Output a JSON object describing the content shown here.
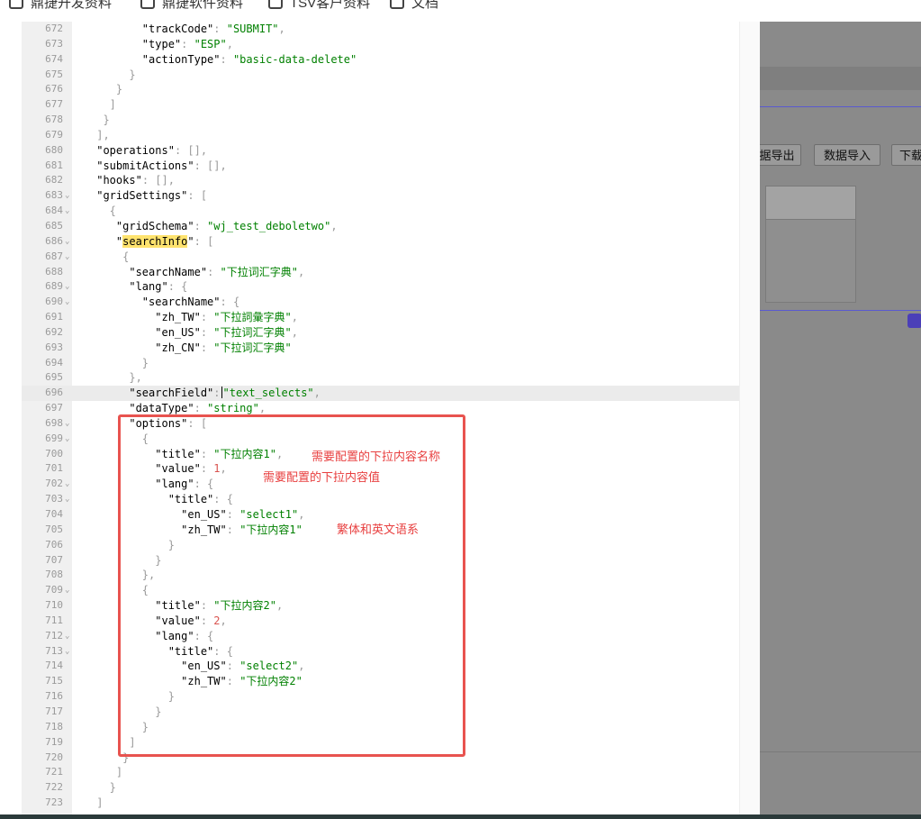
{
  "bookmarks": [
    {
      "label": "鼎捷开发资料"
    },
    {
      "label": "鼎捷软件资料"
    },
    {
      "label": "TSV客户资料"
    },
    {
      "label": "文档"
    }
  ],
  "editor": {
    "active_line": "696",
    "lines": [
      {
        "num": "672",
        "fold": false
      },
      {
        "num": "673",
        "fold": false
      },
      {
        "num": "674",
        "fold": false
      },
      {
        "num": "675",
        "fold": false
      },
      {
        "num": "676",
        "fold": false
      },
      {
        "num": "677",
        "fold": false
      },
      {
        "num": "678",
        "fold": false
      },
      {
        "num": "679",
        "fold": false
      },
      {
        "num": "680",
        "fold": false
      },
      {
        "num": "681",
        "fold": false
      },
      {
        "num": "682",
        "fold": false
      },
      {
        "num": "683",
        "fold": true
      },
      {
        "num": "684",
        "fold": true
      },
      {
        "num": "685",
        "fold": false
      },
      {
        "num": "686",
        "fold": true
      },
      {
        "num": "687",
        "fold": true
      },
      {
        "num": "688",
        "fold": false
      },
      {
        "num": "689",
        "fold": true
      },
      {
        "num": "690",
        "fold": true
      },
      {
        "num": "691",
        "fold": false
      },
      {
        "num": "692",
        "fold": false
      },
      {
        "num": "693",
        "fold": false
      },
      {
        "num": "694",
        "fold": false
      },
      {
        "num": "695",
        "fold": false
      },
      {
        "num": "696",
        "fold": false
      },
      {
        "num": "697",
        "fold": false
      },
      {
        "num": "698",
        "fold": true
      },
      {
        "num": "699",
        "fold": true
      },
      {
        "num": "700",
        "fold": false
      },
      {
        "num": "701",
        "fold": false
      },
      {
        "num": "702",
        "fold": true
      },
      {
        "num": "703",
        "fold": true
      },
      {
        "num": "704",
        "fold": false
      },
      {
        "num": "705",
        "fold": false
      },
      {
        "num": "706",
        "fold": false
      },
      {
        "num": "707",
        "fold": false
      },
      {
        "num": "708",
        "fold": false
      },
      {
        "num": "709",
        "fold": true
      },
      {
        "num": "710",
        "fold": false
      },
      {
        "num": "711",
        "fold": false
      },
      {
        "num": "712",
        "fold": true
      },
      {
        "num": "713",
        "fold": true
      },
      {
        "num": "714",
        "fold": false
      },
      {
        "num": "715",
        "fold": false
      },
      {
        "num": "716",
        "fold": false
      },
      {
        "num": "717",
        "fold": false
      },
      {
        "num": "718",
        "fold": false
      },
      {
        "num": "719",
        "fold": false
      },
      {
        "num": "720",
        "fold": false
      },
      {
        "num": "721",
        "fold": false
      },
      {
        "num": "722",
        "fold": false
      },
      {
        "num": "723",
        "fold": false
      }
    ],
    "code": {
      "trackCode_key": "\"trackCode\"",
      "trackCode_val": "\"SUBMIT\"",
      "type_key": "\"type\"",
      "type_val": "\"ESP\"",
      "actionType_key": "\"actionType\"",
      "actionType_val": "\"basic-data-delete\"",
      "operations_key": "\"operations\"",
      "submitActions_key": "\"submitActions\"",
      "hooks_key": "\"hooks\"",
      "gridSettings_key": "\"gridSettings\"",
      "gridSchema_key": "\"gridSchema\"",
      "gridSchema_val": "\"wj_test_deboletwo\"",
      "searchInfo_key": "searchInfo",
      "searchName_key": "\"searchName\"",
      "searchName_val": "\"下拉词汇字典\"",
      "lang_key": "\"lang\"",
      "zh_TW_key": "\"zh_TW\"",
      "zh_TW_val": "\"下拉詞彙字典\"",
      "en_US_key": "\"en_US\"",
      "en_US_val": "\"下拉词汇字典\"",
      "zh_CN_key": "\"zh_CN\"",
      "zh_CN_val": "\"下拉词汇字典\"",
      "searchField_key": "\"searchField\"",
      "searchField_val": "\"text_selects\"",
      "dataType_key": "\"dataType\"",
      "dataType_val": "\"string\"",
      "options_key": "\"options\"",
      "title_key": "\"title\"",
      "opt1_title": "\"下拉内容1\"",
      "value_key": "\"value\"",
      "opt1_value": "1",
      "opt1_en": "\"select1\"",
      "opt1_tw": "\"下拉内容1\"",
      "opt2_title": "\"下拉内容2\"",
      "opt2_value": "2",
      "opt2_en": "\"select2\"",
      "opt2_tw": "\"下拉内容2\""
    }
  },
  "annotations": {
    "note_title": "需要配置的下拉内容名称",
    "note_value": "需要配置的下拉内容值",
    "note_lang": "繁体和英文语系"
  },
  "right_panel": {
    "export_button": "据导出",
    "import_button": "数据导入",
    "download_button": "下载"
  },
  "colors": {
    "string": "#008000",
    "number": "#d9534f",
    "annotation": "#e84040",
    "highlight": "#ffe36e"
  }
}
